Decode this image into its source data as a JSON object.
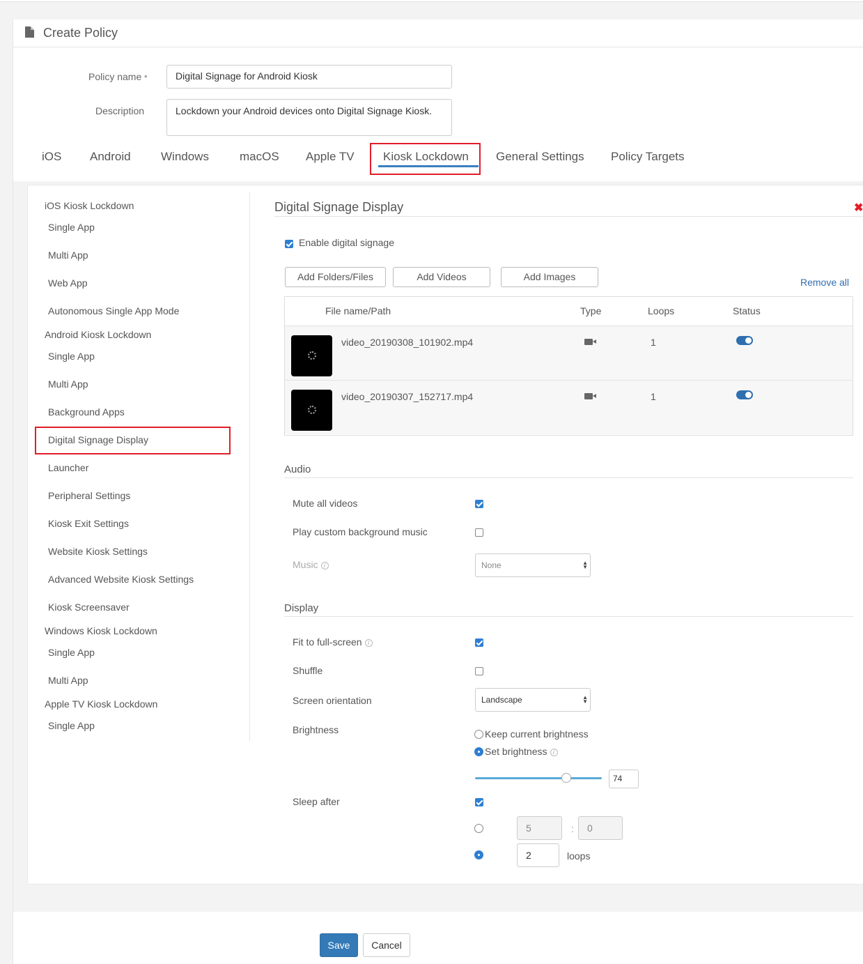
{
  "header": {
    "title": "Create Policy",
    "icon": "document-icon"
  },
  "form": {
    "policy_name_label": "Policy name",
    "policy_name_required": "*",
    "policy_name_value": "Digital Signage for Android Kiosk",
    "description_label": "Description",
    "description_value": "Lockdown your Android devices onto Digital Signage Kiosk."
  },
  "tabs": [
    {
      "label": "iOS"
    },
    {
      "label": "Android"
    },
    {
      "label": "Windows"
    },
    {
      "label": "macOS"
    },
    {
      "label": "Apple TV"
    },
    {
      "label": "Kiosk Lockdown",
      "active": true
    },
    {
      "label": "General Settings"
    },
    {
      "label": "Policy Targets"
    }
  ],
  "sidebar": {
    "groups": [
      {
        "heading": "iOS Kiosk Lockdown",
        "items": [
          "Single App",
          "Multi App",
          "Web App",
          "Autonomous Single App Mode"
        ]
      },
      {
        "heading": "Android Kiosk Lockdown",
        "items": [
          "Single App",
          "Multi App",
          "Background Apps",
          "Digital Signage Display",
          "Launcher",
          "Peripheral Settings",
          "Kiosk Exit Settings",
          "Website Kiosk Settings",
          "Advanced Website Kiosk Settings",
          "Kiosk Screensaver"
        ]
      },
      {
        "heading": "Windows Kiosk Lockdown",
        "items": [
          "Single App",
          "Multi App"
        ]
      },
      {
        "heading": "Apple TV Kiosk Lockdown",
        "items": [
          "Single App"
        ]
      }
    ],
    "selected": "Digital Signage Display"
  },
  "main": {
    "title": "Digital Signage Display",
    "close_icon": "close-icon",
    "enable_label": "Enable digital signage",
    "enable_checked": true,
    "buttons": {
      "add_folders": "Add Folders/Files",
      "add_videos": "Add Videos",
      "add_images": "Add Images",
      "remove_all": "Remove all"
    },
    "table": {
      "headers": [
        "File name/Path",
        "Type",
        "Loops",
        "Status"
      ],
      "rows": [
        {
          "name": "video_20190308_101902.mp4",
          "type_icon": "video-camera-icon",
          "loops": "1",
          "status_on": true
        },
        {
          "name": "video_20190307_152717.mp4",
          "type_icon": "video-camera-icon",
          "loops": "1",
          "status_on": true
        }
      ]
    },
    "audio": {
      "heading": "Audio",
      "mute_label": "Mute all videos",
      "mute_checked": true,
      "custom_music_label": "Play custom background music",
      "custom_music_checked": false,
      "music_label": "Music",
      "music_value": "None"
    },
    "display": {
      "heading": "Display",
      "fit_label": "Fit to full-screen",
      "fit_checked": true,
      "shuffle_label": "Shuffle",
      "shuffle_checked": false,
      "orientation_label": "Screen orientation",
      "orientation_value": "Landscape",
      "brightness_label": "Brightness",
      "keep_brightness_label": "Keep current brightness",
      "set_brightness_label": "Set brightness",
      "brightness_value": "74",
      "brightness_fraction": 0.72,
      "sleep_label": "Sleep after",
      "sleep_checked": true,
      "sleep_minutes": "5",
      "sleep_sep": ":",
      "sleep_seconds": "0",
      "sleep_loops": "2",
      "loops_label": "loops"
    }
  },
  "footer": {
    "save": "Save",
    "cancel": "Cancel"
  }
}
